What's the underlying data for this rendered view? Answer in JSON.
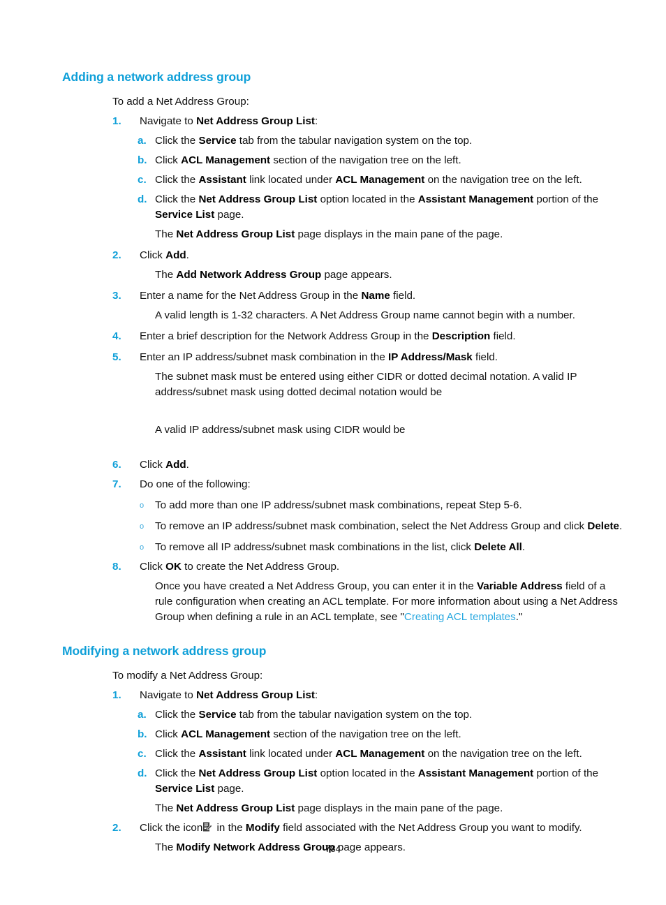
{
  "document": {
    "page_number": "784",
    "accent_color": "#0e9fd8",
    "link_color": "#2aa9e0",
    "text_color": "#111111"
  },
  "sections": [
    {
      "heading": "Adding a network address group",
      "intro": "To add a Net Address Group:"
    },
    {
      "heading": "Modifying a network address group",
      "intro": "To modify a Net Address Group:"
    }
  ],
  "markers": {
    "n1": "1.",
    "n2": "2.",
    "n3": "3.",
    "n4": "4.",
    "n5": "5.",
    "n6": "6.",
    "n7": "7.",
    "n8": "8.",
    "a": "a.",
    "b": "b.",
    "c": "c.",
    "d": "d.",
    "circle": "o"
  },
  "add_section": {
    "step1": {
      "text_before": "Navigate to ",
      "bold": "Net Address Group List",
      "text_after": ":",
      "sub_a": {
        "t1": "Click the ",
        "b1": "Service",
        "t2": " tab from the tabular navigation system on the top."
      },
      "sub_b": {
        "t1": "Click ",
        "b1": "ACL Management",
        "t2": " section of the navigation tree on the left."
      },
      "sub_c": {
        "t1": "Click the ",
        "b1": "Assistant",
        "t2": " link located under ",
        "b2": "ACL Management",
        "t3": " on the navigation tree on the left."
      },
      "sub_d": {
        "t1": "Click the ",
        "b1": "Net Address Group List",
        "t2": " option located in the ",
        "b2": "Assistant Management",
        "t3": " portion of the ",
        "b3": "Service List",
        "t4": " page."
      },
      "result": {
        "t1": "The ",
        "b1": "Net Address Group List",
        "t2": " page displays in the main pane of the page."
      }
    },
    "step2": {
      "t1": "Click ",
      "b1": "Add",
      "t2": ".",
      "result": {
        "t1": "The ",
        "b1": "Add Network Address Group",
        "t2": " page appears."
      }
    },
    "step3": {
      "t1": "Enter a name for the Net Address Group in the ",
      "b1": "Name",
      "t2": " field.",
      "note": "A valid length is 1-32 characters. A Net Address Group name cannot begin with a number."
    },
    "step4": {
      "t1": "Enter a brief description for the Network Address Group in the ",
      "b1": "Description",
      "t2": " field."
    },
    "step5": {
      "t1": "Enter an IP address/subnet mask combination in the ",
      "b1": "IP Address/Mask",
      "t2": " field.",
      "note1": "The subnet mask must be entered using either CIDR or dotted decimal notation. A valid IP address/subnet mask using dotted decimal notation would be",
      "note2": "A valid IP address/subnet mask using CIDR would be"
    },
    "step6": {
      "t1": "Click ",
      "b1": "Add",
      "t2": "."
    },
    "step7": {
      "t1": "Do one of the following:",
      "bullet1": "To add more than one IP address/subnet mask combinations, repeat Step 5-6.",
      "bullet2": {
        "t1": "To remove an IP address/subnet mask combination, select the Net Address Group and click ",
        "b1": "Delete",
        "t2": "."
      },
      "bullet3": {
        "t1": "To remove all IP address/subnet mask combinations in the list, click ",
        "b1": "Delete All",
        "t2": "."
      }
    },
    "step8": {
      "t1": "Click ",
      "b1": "OK",
      "t2": " to create the Net Address Group.",
      "note": {
        "t1": "Once you have created a Net Address Group, you can enter it in the ",
        "b1": "Variable Address",
        "t2": " field of a rule configuration when creating an ACL template. For more information about using a Net Address Group when defining a rule in an ACL template, see \"",
        "link": "Creating ACL templates",
        "t3": ".\""
      }
    }
  },
  "modify_section": {
    "step1": {
      "text_before": "Navigate to ",
      "bold": "Net Address Group List",
      "text_after": ":",
      "sub_a": {
        "t1": "Click the ",
        "b1": "Service",
        "t2": " tab from the tabular navigation system on the top."
      },
      "sub_b": {
        "t1": "Click ",
        "b1": "ACL Management",
        "t2": " section of the navigation tree on the left."
      },
      "sub_c": {
        "t1": "Click the ",
        "b1": "Assistant",
        "t2": " link located under ",
        "b2": "ACL Management",
        "t3": " on the navigation tree on the left."
      },
      "sub_d": {
        "t1": "Click the ",
        "b1": "Net Address Group List",
        "t2": " option located in the ",
        "b2": "Assistant Management",
        "t3": " portion of the ",
        "b3": "Service List",
        "t4": " page."
      },
      "result": {
        "t1": "The ",
        "b1": "Net Address Group List",
        "t2": " page displays in the main pane of the page."
      }
    },
    "step2": {
      "t1": "Click the icon",
      "icon_name": "modify-edit-icon",
      "t2": " in the ",
      "b1": "Modify",
      "t3": " field associated with the Net Address Group you want to modify.",
      "result": {
        "t1": "The ",
        "b1": "Modify Network Address Group",
        "t2": " page appears."
      }
    }
  }
}
